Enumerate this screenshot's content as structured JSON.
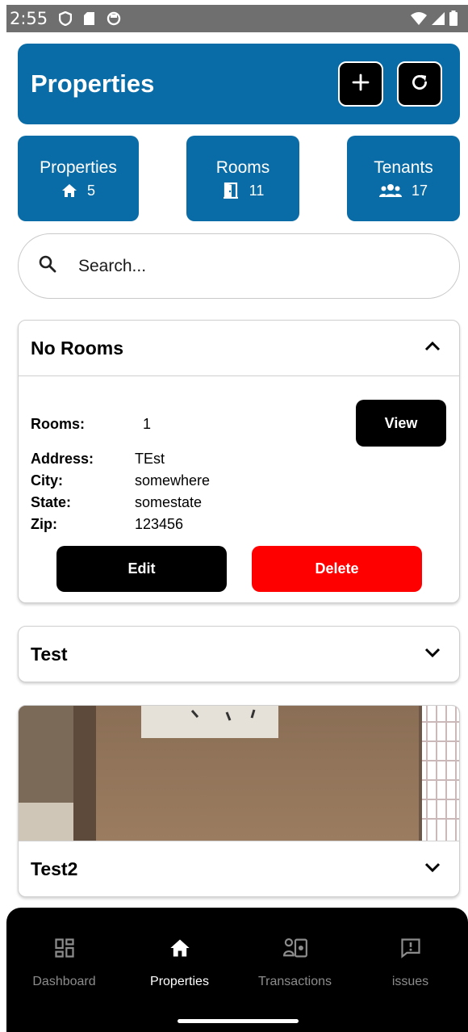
{
  "status_bar": {
    "time": "2:55",
    "icons": [
      "shield-icon",
      "sd-card-icon",
      "sync-icon",
      "wifi-icon",
      "signal-icon",
      "battery-icon"
    ]
  },
  "header": {
    "title": "Properties",
    "actions": [
      "add-icon",
      "refresh-icon"
    ]
  },
  "stats": [
    {
      "label": "Properties",
      "icon": "home-icon",
      "count": "5"
    },
    {
      "label": "Rooms",
      "icon": "door-icon",
      "count": "11"
    },
    {
      "label": "Tenants",
      "icon": "group-icon",
      "count": "17"
    }
  ],
  "search": {
    "placeholder": "Search...",
    "value": ""
  },
  "properties": [
    {
      "name": "No Rooms",
      "expanded": true,
      "rooms_label": "Rooms:",
      "rooms": "1",
      "view_label": "View",
      "address_label": "Address:",
      "address": "TEst",
      "city_label": "City:",
      "city": "somewhere",
      "state_label": "State:",
      "state": "somestate",
      "zip_label": "Zip:",
      "zip": "123456",
      "edit_label": "Edit",
      "delete_label": "Delete"
    },
    {
      "name": "Test",
      "expanded": false
    },
    {
      "name": "Test2",
      "expanded": false,
      "has_photo": true
    }
  ],
  "colors": {
    "brand": "#0a6ca6",
    "danger": "#ff0000",
    "nav_bg": "#000000",
    "nav_inactive": "#8c8c8c"
  },
  "nav": [
    {
      "label": "Dashboard",
      "icon": "dashboard-icon",
      "active": false
    },
    {
      "label": "Properties",
      "icon": "home-icon",
      "active": true
    },
    {
      "label": "Transactions",
      "icon": "transactions-icon",
      "active": false
    },
    {
      "label": "issues",
      "icon": "issue-report-icon",
      "active": false
    }
  ]
}
